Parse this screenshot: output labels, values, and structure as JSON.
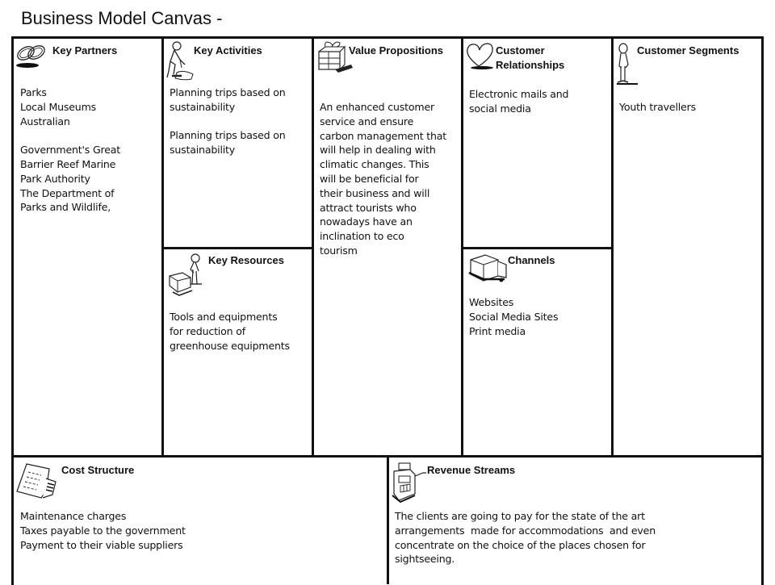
{
  "title": "Business Model Canvas -",
  "blocks": {
    "key_partners": {
      "icon": "chain-link-icon",
      "header": "Key Partners",
      "body": "Parks\nLocal Museums\nAustralian\n\nGovernment's Great\nBarrier Reef Marine\nPark Authority\nThe Department of\nParks and Wildlife,"
    },
    "key_activities": {
      "icon": "worker-icon",
      "header": "Key Activities",
      "body": "Planning trips based on\nsustainability\n\nPlanning trips based on\nsustainability"
    },
    "value_propositions": {
      "icon": "gift-icon",
      "header": "Value Propositions",
      "body": "An enhanced customer\nservice and ensure\ncarbon management that\nwill help in dealing with\nclimatic changes. This\nwill be beneficial for\ntheir business and will\nattract tourists who\nnowadays have an\ninclination to eco\ntourism"
    },
    "customer_relationships": {
      "icon": "heart-icon",
      "header": "Customer\nRelationships",
      "body": "Electronic mails and\nsocial media"
    },
    "customer_segments": {
      "icon": "person-icon",
      "header": "Customer Segments",
      "body": "Youth travellers"
    },
    "key_resources": {
      "icon": "person-with-machine-icon",
      "header": "Key Resources",
      "body": "Tools and equipments\nfor reduction of\ngreenhouse equipments"
    },
    "channels": {
      "icon": "truck-icon",
      "header": "Channels",
      "body": "Websites\nSocial Media Sites\nPrint media"
    },
    "cost_structure": {
      "icon": "receipt-icon",
      "header": "Cost Structure",
      "body": "Maintenance charges\nTaxes payable to the government\nPayment to their viable suppliers"
    },
    "revenue_streams": {
      "icon": "cash-register-icon",
      "header": "Revenue Streams",
      "body": "The clients are going to pay for the state of the art\narrangements  made for accommodations  and even\nconcentrate on the choice of the places chosen for\nsightseeing."
    }
  }
}
